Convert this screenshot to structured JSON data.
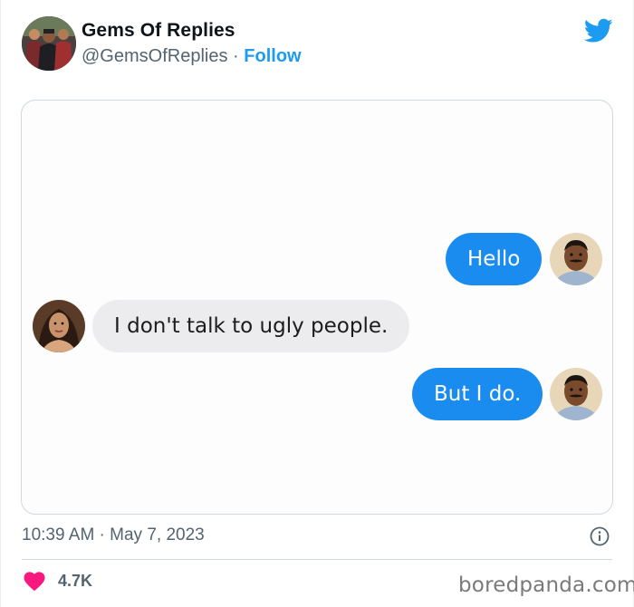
{
  "author": {
    "display_name": "Gems Of Replies",
    "handle": "@GemsOfReplies",
    "separator": "·",
    "follow_label": "Follow"
  },
  "chat": {
    "messages": [
      {
        "side": "sent",
        "text": "Hello"
      },
      {
        "side": "received",
        "text": "I don't talk to ugly people."
      },
      {
        "side": "sent",
        "text": "But I do."
      }
    ]
  },
  "footer": {
    "timestamp": "10:39 AM · May 7, 2023",
    "likes": "4.7K",
    "watermark": "boredpanda.com"
  },
  "colors": {
    "twitter_blue": "#1d9bf0",
    "sent_bubble": "#1a8cf0",
    "received_bubble": "#ececee",
    "heart": "#f91880",
    "secondary_text": "#536471"
  },
  "icons": {
    "brand": "twitter-bird-icon",
    "info": "info-icon",
    "like": "heart-icon"
  }
}
